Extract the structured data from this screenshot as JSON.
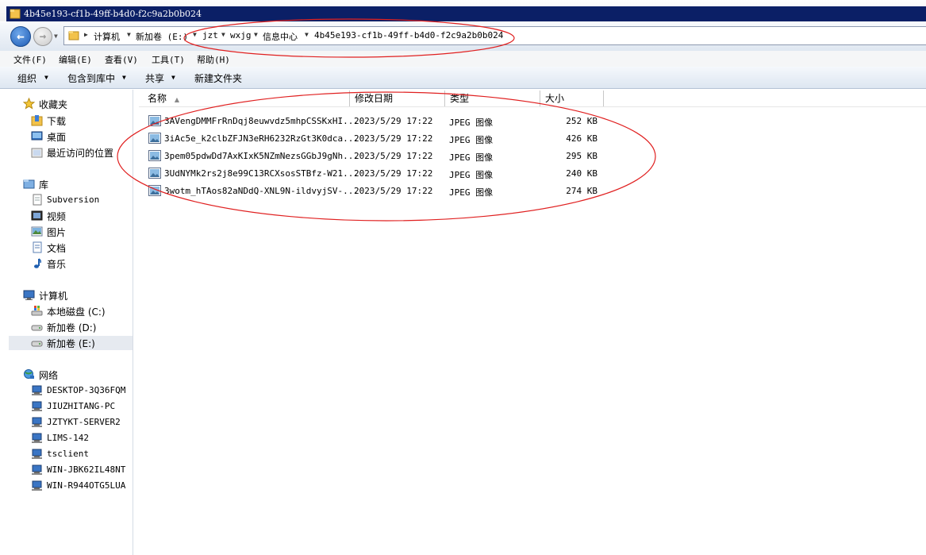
{
  "window": {
    "title": "4b45e193-cf1b-49ff-b4d0-f2c9a2b0b024"
  },
  "address": {
    "crumbs": [
      "计算机",
      "新加卷 (E:)",
      "jzt",
      "wxjg",
      "信息中心",
      "4b45e193-cf1b-49ff-b4d0-f2c9a2b0b024"
    ]
  },
  "menu": [
    "文件(F)",
    "编辑(E)",
    "查看(V)",
    "工具(T)",
    "帮助(H)"
  ],
  "toolbar": {
    "organize": "组织",
    "include": "包含到库中",
    "share": "共享",
    "new_folder": "新建文件夹"
  },
  "nav": {
    "favorites": {
      "label": "收藏夹",
      "items": [
        "下载",
        "桌面",
        "最近访问的位置"
      ]
    },
    "libraries": {
      "label": "库",
      "items": [
        "Subversion",
        "视频",
        "图片",
        "文档",
        "音乐"
      ]
    },
    "computer": {
      "label": "计算机",
      "items": [
        "本地磁盘 (C:)",
        "新加卷 (D:)",
        "新加卷 (E:)"
      ]
    },
    "network": {
      "label": "网络",
      "items": [
        "DESKTOP-3Q36FQM",
        "JIUZHITANG-PC",
        "JZTYKT-SERVER2",
        "LIMS-142",
        "tsclient",
        "WIN-JBK62IL48NT",
        "WIN-R944OTG5LUA"
      ]
    }
  },
  "columns": {
    "name": "名称",
    "date": "修改日期",
    "type": "类型",
    "size": "大小"
  },
  "files": [
    {
      "name": "3AVengDMMFrRnDqj8euwvdz5mhpCSSKxHI...",
      "date": "2023/5/29 17:22",
      "type": "JPEG 图像",
      "size": "252 KB"
    },
    {
      "name": "3iAc5e_k2clbZFJN3eRH6232RzGt3K0dca...",
      "date": "2023/5/29 17:22",
      "type": "JPEG 图像",
      "size": "426 KB"
    },
    {
      "name": "3pem05pdwDd7AxKIxK5NZmNezsGGbJ9gNh...",
      "date": "2023/5/29 17:22",
      "type": "JPEG 图像",
      "size": "295 KB"
    },
    {
      "name": "3UdNYMk2rs2j8e99C13RCXsosSTBfz-W21...",
      "date": "2023/5/29 17:22",
      "type": "JPEG 图像",
      "size": "240 KB"
    },
    {
      "name": "3wotm_hTAos82aNDdQ-XNL9N-ildvyjSV-...",
      "date": "2023/5/29 17:22",
      "type": "JPEG 图像",
      "size": "274 KB"
    }
  ],
  "colors": {
    "annotation": "#e02020",
    "titlebar": "#0b1f66"
  }
}
